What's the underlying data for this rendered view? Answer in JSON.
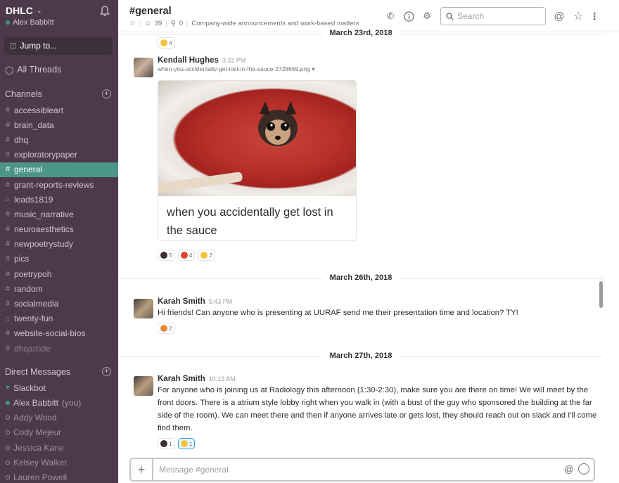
{
  "workspace": {
    "name": "DHLC",
    "user": "Alex Babbitt"
  },
  "sidebar": {
    "jump_label": "Jump to...",
    "threads_label": "All Threads",
    "channels_header": "Channels",
    "channels": [
      {
        "name": "accessibleart",
        "type": "public",
        "state": "normal"
      },
      {
        "name": "brain_data",
        "type": "public",
        "state": "normal"
      },
      {
        "name": "dhq",
        "type": "public",
        "state": "normal"
      },
      {
        "name": "exploratorypaper",
        "type": "public",
        "state": "normal"
      },
      {
        "name": "general",
        "type": "public",
        "state": "active"
      },
      {
        "name": "grant-reports-reviews",
        "type": "public",
        "state": "normal"
      },
      {
        "name": "leads1819",
        "type": "private",
        "state": "normal"
      },
      {
        "name": "music_narrative",
        "type": "public",
        "state": "normal"
      },
      {
        "name": "neuroaesthetics",
        "type": "public",
        "state": "normal"
      },
      {
        "name": "newpoetrystudy",
        "type": "public",
        "state": "normal"
      },
      {
        "name": "pics",
        "type": "public",
        "state": "normal"
      },
      {
        "name": "poetrypoh",
        "type": "public",
        "state": "normal"
      },
      {
        "name": "random",
        "type": "public",
        "state": "normal"
      },
      {
        "name": "socialmedia",
        "type": "public",
        "state": "normal"
      },
      {
        "name": "twenty-fun",
        "type": "private",
        "state": "normal"
      },
      {
        "name": "website-social-bios",
        "type": "public",
        "state": "normal"
      },
      {
        "name": "dhqarticle",
        "type": "public",
        "state": "muted"
      }
    ],
    "dm_header": "Direct Messages",
    "dms": [
      {
        "name": "Slackbot",
        "status": "heart",
        "suffix": ""
      },
      {
        "name": "Alex Babbitt",
        "status": "online",
        "suffix": "(you)"
      },
      {
        "name": "Addy Wood",
        "status": "offline",
        "suffix": ""
      },
      {
        "name": "Cody Mejeur",
        "status": "offline",
        "suffix": ""
      },
      {
        "name": "Jessica Kane",
        "status": "offline",
        "suffix": ""
      },
      {
        "name": "Kelsey Walker",
        "status": "offline",
        "suffix": ""
      },
      {
        "name": "Lauren Powell",
        "status": "offline",
        "suffix": ""
      }
    ]
  },
  "header": {
    "channel": "#general",
    "members": "39",
    "pins": "0",
    "topic": "Company-wide announcements and work-based matters",
    "search_placeholder": "Search"
  },
  "dates": {
    "d1": "March 23rd, 2018",
    "d2": "March 26th, 2018",
    "d3": "March 27th, 2018"
  },
  "messages": {
    "top_reaction": {
      "count": "4"
    },
    "kendall": {
      "author": "Kendall Hughes",
      "time": "3:31 PM",
      "file": "when-you-accidentally-get-lost-in-the-sauce-2728669.png",
      "caption": "when you accidentally get lost in the sauce",
      "reactions": [
        {
          "emoji": "dog",
          "count": "5"
        },
        {
          "emoji": "fire",
          "count": "4"
        },
        {
          "emoji": "laugh",
          "count": "2"
        }
      ]
    },
    "karah1": {
      "author": "Karah Smith",
      "time": "5:43 PM",
      "text": "Hi friends! Can anyone who is presenting at UURAF send me their presentation time and location? TY!",
      "reactions": [
        {
          "emoji": "tada",
          "count": "2"
        }
      ]
    },
    "karah2": {
      "author": "Karah Smith",
      "time": "10:13 AM",
      "text": "For anyone who is joining us at Radiology this afternoon (1:30-2:30), make sure you are there on time! We will meet by the front doors. There is a atrium style lobby right when you walk in (with a bust of the guy who sponsored the building at the far side of the room). We can meet there and then if anyone arrives late or gets lost, they should reach out on slack and I'll come find them.",
      "reactions": [
        {
          "emoji": "dog",
          "count": "1"
        },
        {
          "emoji": "thumbsup",
          "count": "1"
        }
      ]
    }
  },
  "composer": {
    "placeholder": "Message #general"
  }
}
